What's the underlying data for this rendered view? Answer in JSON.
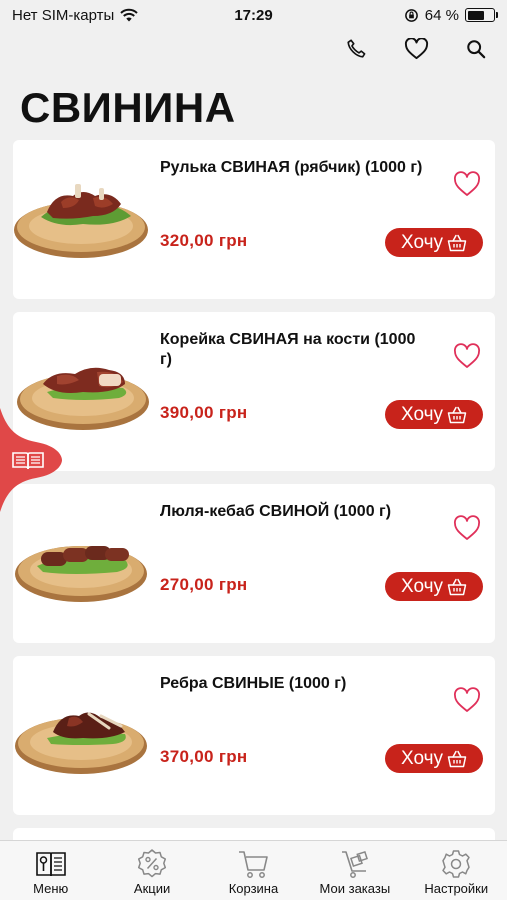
{
  "status_bar": {
    "carrier": "Нет SIM-карты",
    "time": "17:29",
    "battery": "64 %",
    "battery_level": 0.64
  },
  "page_title": "СВИНИНА",
  "products": [
    {
      "name": "Рулька СВИНАЯ (рябчик) (1000 г)",
      "price": "320,00 грн",
      "want_label": "Хочу"
    },
    {
      "name": "Корейка СВИНАЯ на кости (1000 г)",
      "price": "390,00 грн",
      "want_label": "Хочу"
    },
    {
      "name": "Люля-кебаб СВИНОЙ  (1000 г)",
      "price": "270,00 грн",
      "want_label": "Хочу"
    },
    {
      "name": "Ребра СВИНЫЕ  (1000 г)",
      "price": "370,00 грн",
      "want_label": "Хочу"
    }
  ],
  "bottom_nav": [
    {
      "label": "Меню",
      "icon": "menu-book-icon"
    },
    {
      "label": "Акции",
      "icon": "discount-icon"
    },
    {
      "label": "Корзина",
      "icon": "cart-icon"
    },
    {
      "label": "Мои заказы",
      "icon": "orders-icon"
    },
    {
      "label": "Настройки",
      "icon": "gear-icon"
    }
  ],
  "colors": {
    "accent": "#c8231b",
    "favorite": "#e0305a",
    "background": "#f0f0f0",
    "menu_tab": "#e04848"
  }
}
